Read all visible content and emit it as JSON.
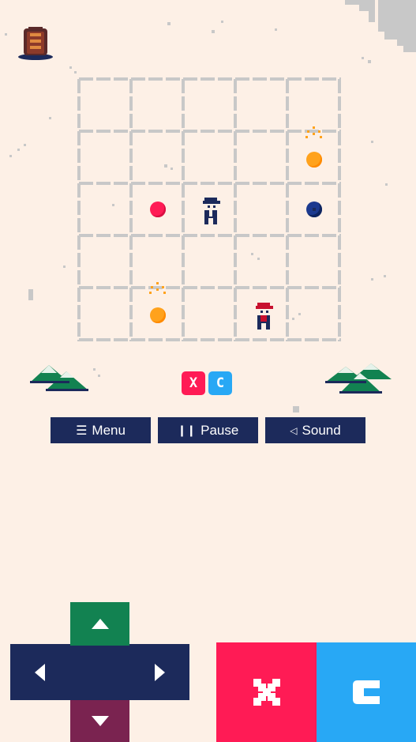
{
  "menu_bar": {
    "menu_label": "Menu",
    "pause_label": "Pause",
    "sound_label": "Sound"
  },
  "logo": {
    "left_letter": "X",
    "right_letter": "C"
  },
  "colors": {
    "background": "#fdf0e6",
    "grid": "#c8c8c8",
    "navy": "#1c2a5b",
    "pink": "#ff1b55",
    "blue": "#28a8f5",
    "green": "#128251",
    "maroon": "#7a2350",
    "orange": "#ffa21c"
  },
  "icons": {
    "menu": "hamburger-icon",
    "pause": "pause-icon",
    "sound": "speaker-icon",
    "trophy": "trophy-icon"
  },
  "board": {
    "columns": 5,
    "rows": 5
  }
}
